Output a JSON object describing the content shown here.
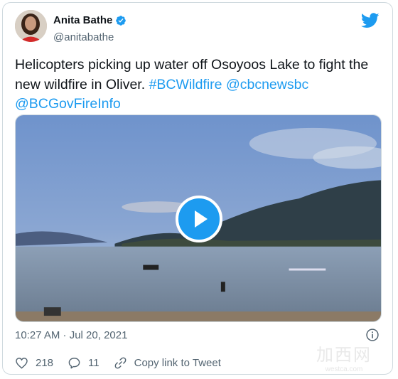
{
  "author": {
    "display_name": "Anita Bathe",
    "handle": "@anitabathe"
  },
  "tweet": {
    "text_plain": "Helicopters picking up water off Osoyoos Lake to fight the new wildfire in Oliver. ",
    "hashtag": "#BCWildfire",
    "mention_1": "@cbcnewsbc",
    "mention_2": "@BCGovFireInfo"
  },
  "meta": {
    "timestamp": "10:27 AM · Jul 20, 2021"
  },
  "actions": {
    "likes": "218",
    "replies": "11",
    "copy_link_label": "Copy link to Tweet"
  },
  "watermark": {
    "main": "加西网",
    "sub": "westca.com"
  },
  "colors": {
    "accent": "#1d9bf0",
    "text_primary": "#0f1419",
    "text_secondary": "#536471",
    "border": "#cfd9de"
  },
  "icons": {
    "brand": "twitter-bird-icon",
    "verified": "verified-badge-icon",
    "play": "play-icon",
    "info": "info-icon",
    "like": "heart-icon",
    "reply": "reply-bubble-icon",
    "copy_link": "link-icon"
  }
}
